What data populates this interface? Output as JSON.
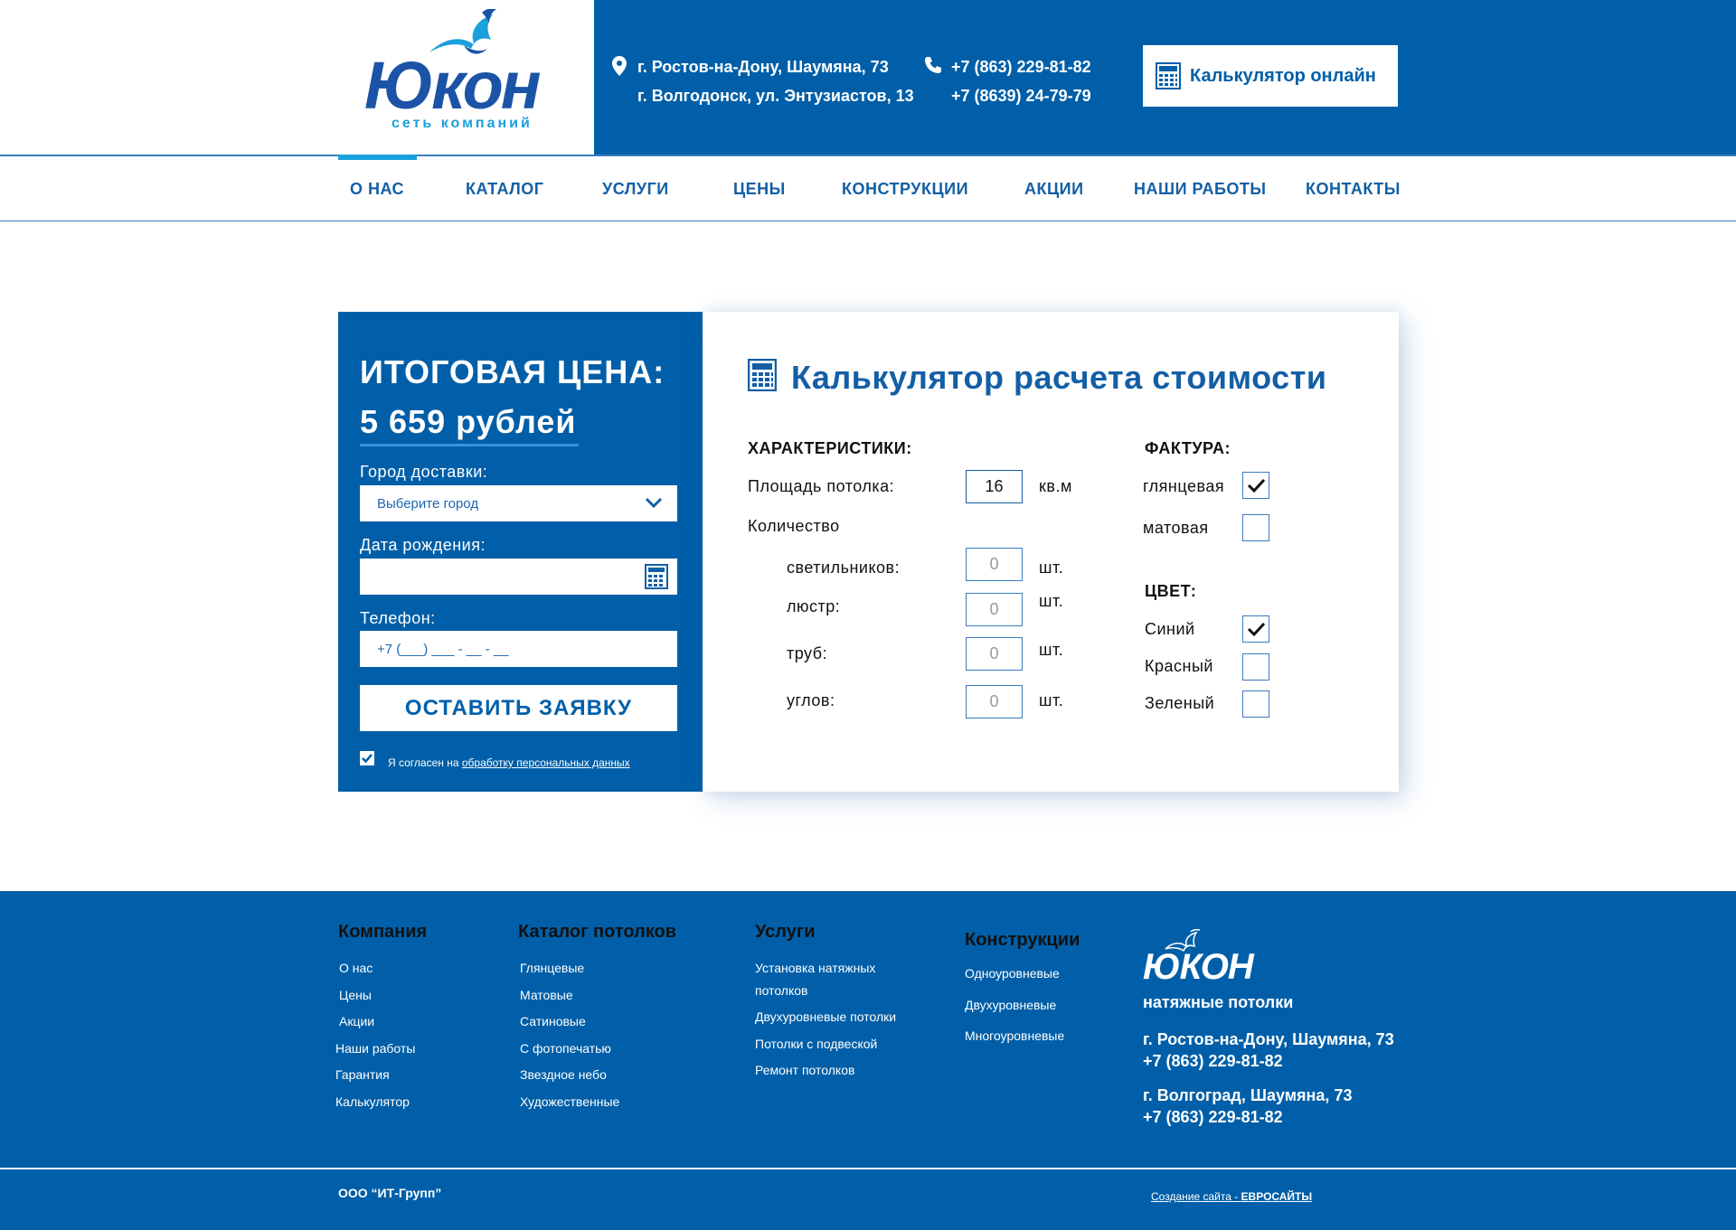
{
  "colors": {
    "brand_blue": "#005fa8",
    "accent_cyan": "#1aa0dc",
    "white": "#ffffff"
  },
  "header": {
    "logo": {
      "word": "Юкон",
      "subtitle": "сеть компаний"
    },
    "addresses": [
      "г. Ростов-на-Дону, Шаумяна, 73",
      "г. Волгодонск, ул. Энтузиастов, 13"
    ],
    "phones": [
      "+7 (863) 229-81-82",
      "+7 (8639) 24-79-79"
    ],
    "calc_button": "Калькулятор онлайн",
    "icons": {
      "address": "map-pin-icon",
      "phone": "phone-icon",
      "calc": "calculator-icon"
    }
  },
  "nav": {
    "active": "О НАС",
    "items": [
      "О НАС",
      "КАТАЛОГ",
      "УСЛУГИ",
      "ЦЕНЫ",
      "КОНСТРУКЦИИ",
      "АКЦИИ",
      "НАШИ РАБОТЫ",
      "КОНТАКТЫ"
    ]
  },
  "order": {
    "price_label": "ИТОГОВАЯ ЦЕНА:",
    "price_value": "5 659 рублей",
    "city_label": "Город доставки:",
    "city_value": "Выберите город",
    "birth_label": "Дата рождения:",
    "birth_value": "",
    "phone_label": "Телефон:",
    "phone_placeholder": "+7 (___) ___ - __ - __",
    "submit": "ОСТАВИТЬ ЗАЯВКУ",
    "agree_checked": true,
    "agree_text": "Я согласен на ",
    "agree_link": "обработку персональных данных"
  },
  "calculator": {
    "title": "Калькулятор расчета стоимости",
    "characteristics_title": "ХАРАКТЕРИСТИКИ:",
    "area_label": "Площадь потолка:",
    "area_value": "16",
    "area_unit": "кв.м",
    "quantity_label": "Количество",
    "fixtures_label": "светильников:",
    "fixtures_value": "0",
    "chandeliers_label": "люстр:",
    "chandeliers_value": "0",
    "pipes_label": "труб:",
    "pipes_value": "0",
    "corners_label": "углов:",
    "corners_value": "0",
    "pcs_unit": "шт.",
    "texture_title": "ФАКТУРА:",
    "textures": [
      {
        "label": "глянцевая",
        "checked": true
      },
      {
        "label": "матовая",
        "checked": false
      }
    ],
    "color_title": "ЦВЕТ:",
    "colors": [
      {
        "label": "Синий",
        "checked": true
      },
      {
        "label": "Красный",
        "checked": false
      },
      {
        "label": "Зеленый",
        "checked": false
      }
    ]
  },
  "footer": {
    "company_title": "Компания",
    "company_links": [
      "О нас",
      "Цены",
      "Акции",
      "Наши работы",
      "Гарантия",
      "Калькулятор"
    ],
    "catalog_title": "Каталог потолков",
    "catalog_links": [
      "Глянцевые",
      "Матовые",
      "Сатиновые",
      "С фотопечатью",
      "Звездное небо",
      "Художественные"
    ],
    "services_title": "Услуги",
    "services_links": [
      "Установка натяжных",
      "потолков",
      "Двухуровневые потолки",
      "Потолки с подвеской",
      "Ремонт потолков"
    ],
    "constructions_title": "Конструкции",
    "constructions_links": [
      "Одноуровневые",
      "Двухуровневые",
      "Многоуровневые"
    ],
    "logo_word": "ЮКОН",
    "logo_sub": "натяжные потолки",
    "contact1_address": "г. Ростов-на-Дону, Шаумяна, 73",
    "contact1_phone": "+7 (863) 229-81-82",
    "contact2_address": "г. Волгоград, Шаумяна, 73",
    "contact2_phone": "+7 (863) 229-81-82",
    "copyright": "ООО “ИТ-Групп”",
    "credit_text": "Создание сайта - ",
    "credit_brand": "ЕВРОСАЙТЫ"
  }
}
